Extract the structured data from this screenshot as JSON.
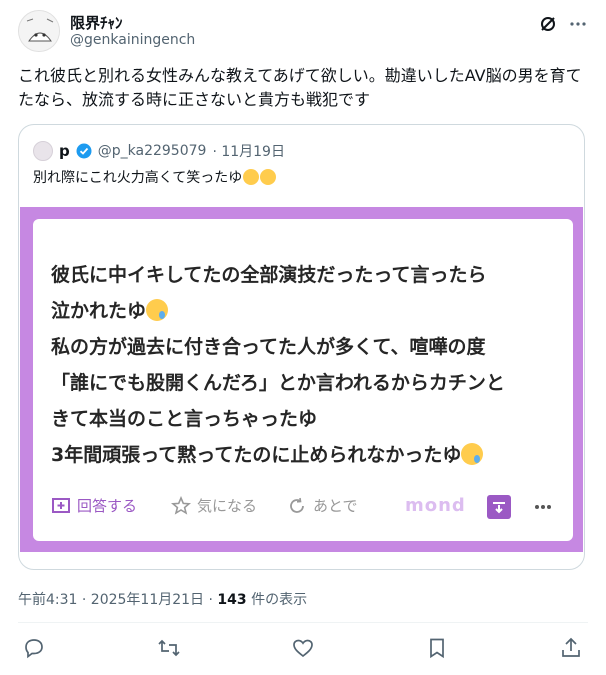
{
  "author": {
    "name": "限界ﾁｬﾝ",
    "handle": "@genkainingench"
  },
  "post": {
    "text": "これ彼氏と別れる女性みんな教えてあげて欲しい。勘違いしたAV脳の男を育てたなら、放流する時に正さないと貴方も戦犯です"
  },
  "quote": {
    "name": "p",
    "handle": "@p_ka2295079",
    "date": "· 11月19日",
    "text": "別れ際にこれ火力高くて笑ったゆ"
  },
  "card": {
    "line1": "彼氏に中イキしてたの全部演技だったって言ったら",
    "line2": "泣かれたゆ",
    "line3": "私の方が過去に付き合ってた人が多くて、喧嘩の度",
    "line4": "「誰にでも股開くんだろ」とか言われるからカチンと",
    "line5": "きて本当のこと言っちゃったゆ",
    "line6": "3年間頑張って黙ってたのに止められなかったゆ",
    "answer_label": "回答する",
    "like_label": "気になる",
    "later_label": "あとで",
    "brand": "mond"
  },
  "meta": {
    "time": "午前4:31 · 2025年11月21日 · ",
    "views": "143",
    "views_suffix": " 件の表示"
  },
  "colors": {
    "accent": "#1d9bf0",
    "mond_purple": "#c688e2",
    "text": "#0f1419",
    "muted": "#536471"
  },
  "icons": [
    "grok-icon",
    "more-icon",
    "verified-icon",
    "reply-icon",
    "repost-icon",
    "like-icon",
    "bookmark-icon",
    "share-icon"
  ]
}
